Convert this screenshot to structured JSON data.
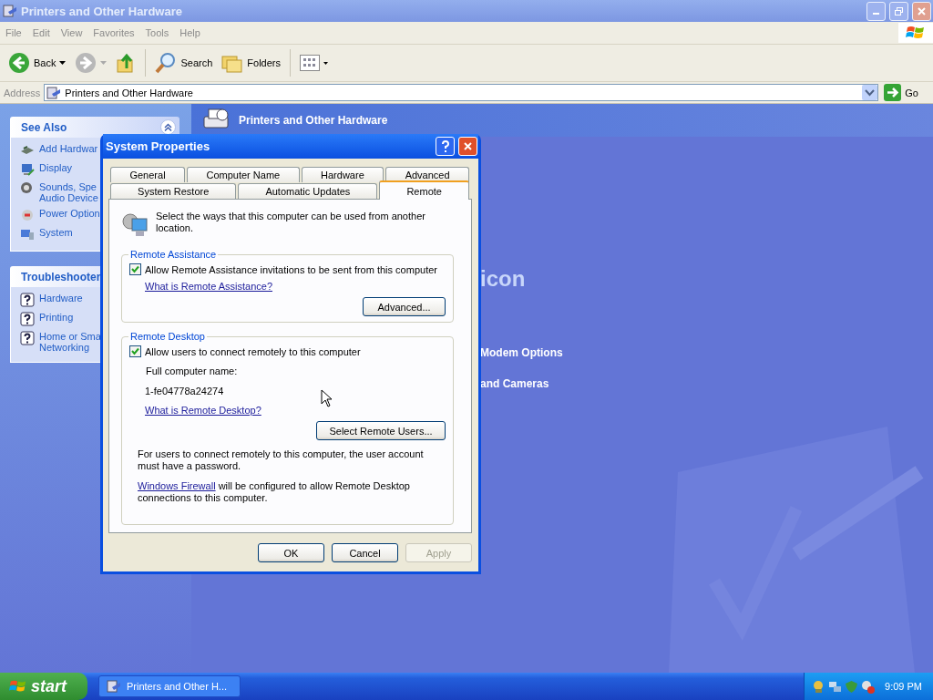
{
  "window": {
    "title": "Printers and Other Hardware"
  },
  "menu": [
    "File",
    "Edit",
    "View",
    "Favorites",
    "Tools",
    "Help"
  ],
  "toolbar": {
    "back": "Back",
    "search": "Search",
    "folders": "Folders"
  },
  "address": {
    "label": "Address",
    "value": "Printers and Other Hardware",
    "go": "Go"
  },
  "sidebar": [
    {
      "title": "See Also",
      "expanded": true,
      "items": [
        {
          "kind": "hardware",
          "lines": [
            "Add Hardwar"
          ]
        },
        {
          "kind": "display",
          "lines": [
            "Display"
          ]
        },
        {
          "kind": "sounds",
          "lines": [
            "Sounds, Spe",
            "Audio Device"
          ]
        },
        {
          "kind": "power",
          "lines": [
            "Power Option"
          ]
        },
        {
          "kind": "system",
          "lines": [
            "System"
          ]
        }
      ]
    },
    {
      "title": "Troubleshooter",
      "items": [
        {
          "kind": "help",
          "lines": [
            "Hardware"
          ]
        },
        {
          "kind": "help",
          "lines": [
            "Printing"
          ]
        },
        {
          "kind": "help",
          "lines": [
            "Home or Sma",
            "Networking"
          ]
        }
      ]
    }
  ],
  "content": {
    "header": "Printers and Other Hardware",
    "fragments": [
      {
        "kind": "heading",
        "text": "icon"
      },
      {
        "kind": "task",
        "text": "Modem Options"
      },
      {
        "kind": "task",
        "text": "and Cameras"
      }
    ]
  },
  "dialog": {
    "title": "System Properties",
    "tab_rows": [
      [
        {
          "label": "General",
          "selected": false
        },
        {
          "label": "Computer Name",
          "selected": false
        },
        {
          "label": "Hardware",
          "selected": false
        },
        {
          "label": "Advanced",
          "selected": false
        }
      ],
      [
        {
          "label": "System Restore",
          "selected": false
        },
        {
          "label": "Automatic Updates",
          "selected": false
        },
        {
          "label": "Remote",
          "selected": true
        }
      ]
    ],
    "intro": "Select the ways that this computer can be used from another location.",
    "assistance": {
      "title": "Remote Assistance",
      "checkbox": {
        "label": "Allow Remote Assistance invitations to be sent from this computer",
        "checked": true
      },
      "link": "What is Remote Assistance?",
      "button": "Advanced..."
    },
    "desktop": {
      "title": "Remote Desktop",
      "checkbox": {
        "label": "Allow users to connect remotely to this computer",
        "checked": true
      },
      "name_label": "Full computer name:",
      "name_value": "1-fe04778a24274",
      "link": "What is Remote Desktop?",
      "button": "Select Remote Users...",
      "note": "For users to connect remotely to this computer, the user account must have a password.",
      "firewall_link": "Windows Firewall",
      "firewall_text": "will be configured to allow Remote Desktop connections to this computer."
    },
    "buttons": [
      {
        "label": "OK",
        "disabled": false
      },
      {
        "label": "Cancel",
        "disabled": false
      },
      {
        "label": "Apply",
        "disabled": true
      }
    ]
  },
  "taskbar": {
    "start": "start",
    "task": "Printers and Other H...",
    "clock": "9:09 PM"
  }
}
